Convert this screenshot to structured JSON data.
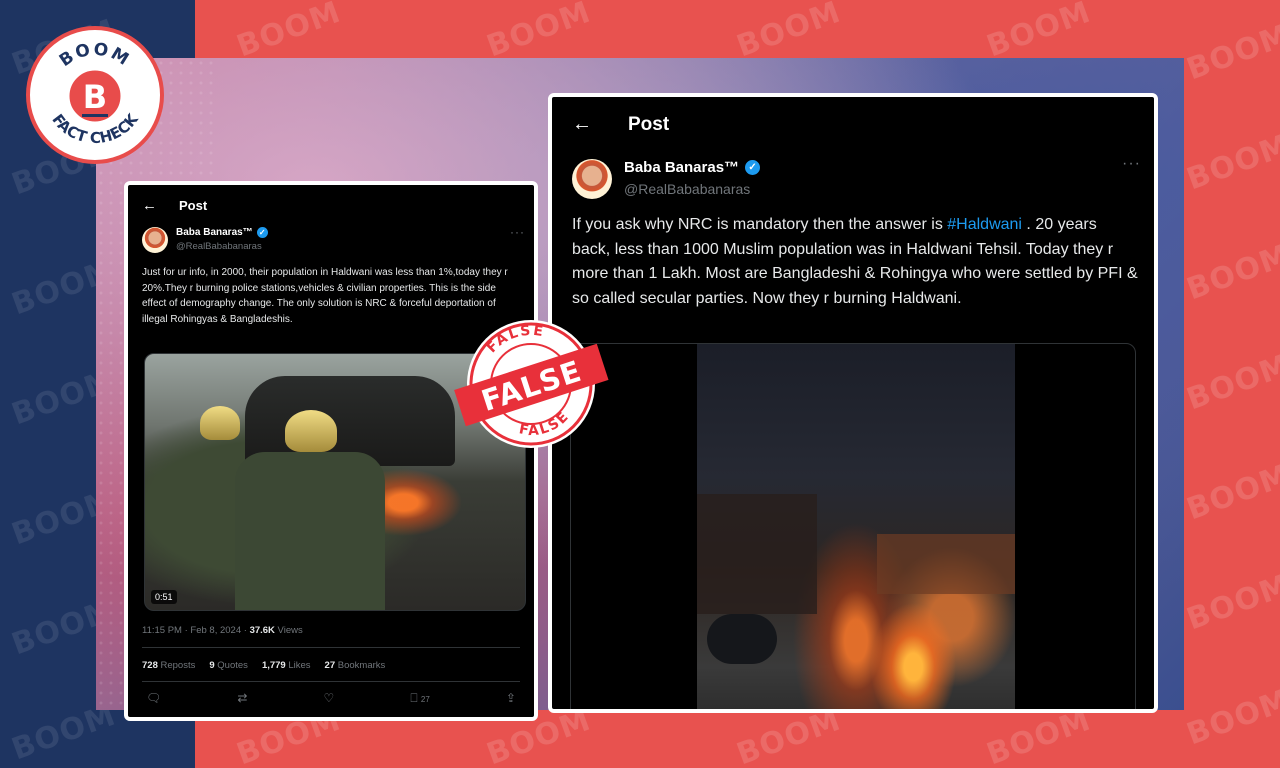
{
  "watermark": {
    "text": "BOOM"
  },
  "logo": {
    "top_text": "BOOM",
    "letter": "B",
    "bottom_text": "FACT CHECK",
    "colors": {
      "red": "#e84c4b",
      "navy": "#1e3461"
    }
  },
  "left_tweet": {
    "header_title": "Post",
    "author_name": "Baba Banaras™",
    "author_handle": "@RealBababanaras",
    "text": "Just for ur info, in 2000, their population in Haldwani was less than 1%,today they r 20%.They r burning police stations,vehicles & civilian properties. This is the side effect of demography change. The only solution is NRC & forceful deportation of illegal Rohingyas & Bangladeshis.",
    "video_duration": "0:51",
    "timestamp": "11:15 PM · Feb 8, 2024 · ",
    "views_count": "37.6K",
    "views_label": " Views",
    "stats": [
      {
        "count": "728",
        "label": "Reposts"
      },
      {
        "count": "9",
        "label": "Quotes"
      },
      {
        "count": "1,779",
        "label": "Likes"
      },
      {
        "count": "27",
        "label": "Bookmarks"
      }
    ],
    "bookmark_count": "27"
  },
  "right_tweet": {
    "header_title": "Post",
    "author_name": "Baba Banaras™",
    "author_handle": "@RealBababanaras",
    "text_before": "If you ask why NRC is mandatory then the answer is ",
    "hashtag": "#Haldwani",
    "text_after": " . 20 years back, less than 1000 Muslim population was in Haldwani Tehsil. Today they r more than 1 Lakh. Most are Bangladeshi & Rohingya who were settled by PFI & so called secular parties. Now they r burning Haldwani."
  },
  "stamp": {
    "top_text": "FALSE",
    "center_text": "FALSE",
    "bottom_text": "FALSE",
    "color": "#e8303a"
  }
}
